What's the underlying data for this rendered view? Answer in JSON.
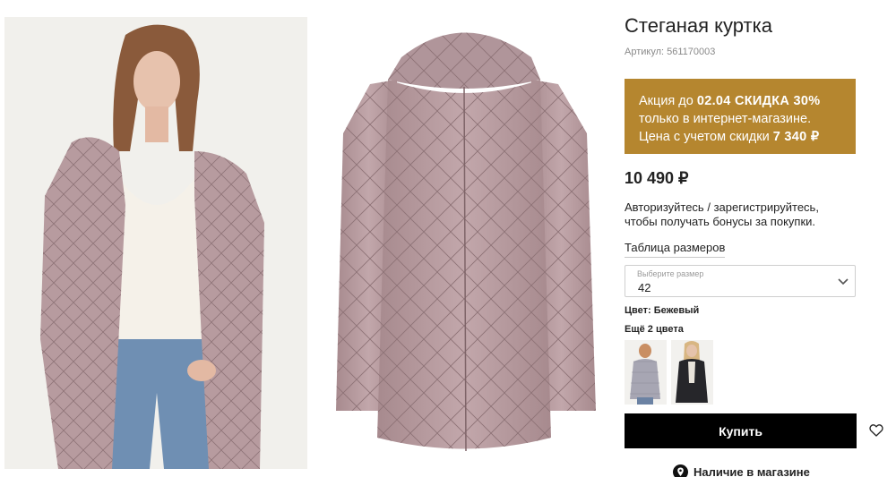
{
  "product": {
    "title": "Стеганая куртка",
    "article": "Артикул: 561170003",
    "price": "10 490 ₽"
  },
  "promo": {
    "line1_prefix": "Акция до ",
    "line1_strong": "02.04 СКИДКА 30%",
    "line2": "только в интернет-магазине.",
    "line3_prefix": "Цена с учетом скидки ",
    "line3_strong": "7 340 ₽",
    "background": "#b5862f"
  },
  "auth": {
    "login_link": "Авторизуйтесь",
    "separator": " / ",
    "register_link": "зарегистрируйтесь,",
    "line2": "чтобы получать бонусы за покупки."
  },
  "size": {
    "table_link": "Таблица размеров",
    "placeholder": "Выберите размер",
    "selected": "42"
  },
  "color": {
    "label": "Цвет: Бежевый",
    "more": "Ещё 2 цвета",
    "swatches": [
      "grey-jacket-thumbnail",
      "black-jacket-thumbnail"
    ]
  },
  "actions": {
    "buy_label": "Купить",
    "wishlist_icon": "heart-icon",
    "store_icon": "location-pin-icon",
    "store_label": "Наличие в магазине"
  },
  "colors": {
    "jacket": "#b79b9f",
    "button": "#000000"
  }
}
